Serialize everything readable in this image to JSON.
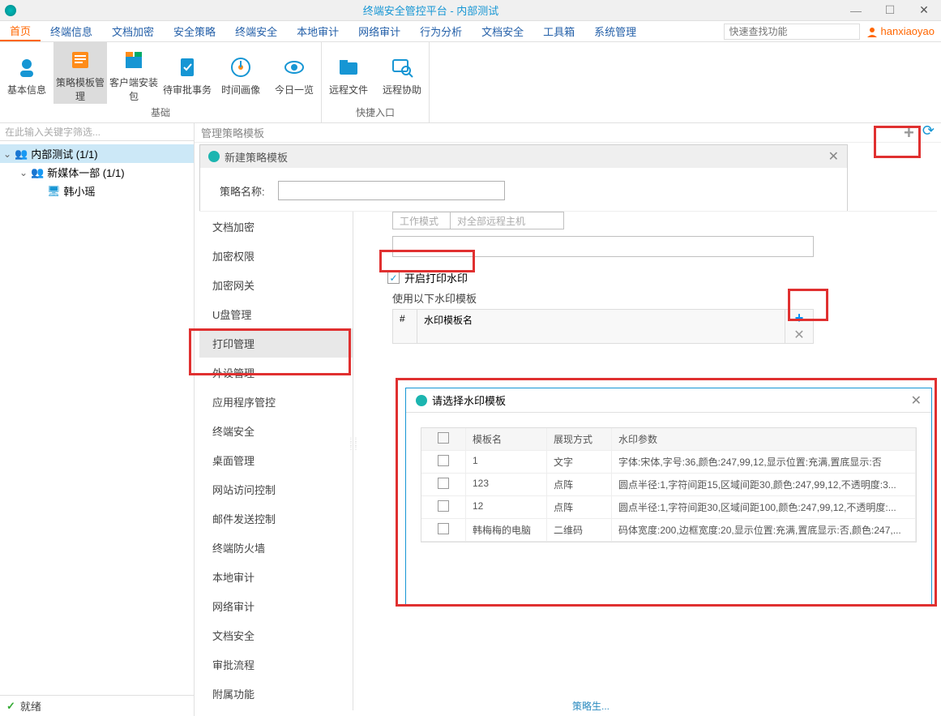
{
  "title": "终端安全管控平台 - 内部测试",
  "tabs": [
    "首页",
    "终端信息",
    "文档加密",
    "安全策略",
    "终端安全",
    "本地审计",
    "网络审计",
    "行为分析",
    "文档安全",
    "工具箱",
    "系统管理"
  ],
  "active_tab": 0,
  "search_placeholder": "快速查找功能",
  "user": "hanxiaoyao",
  "ribbon": {
    "groups": [
      {
        "label": "基础",
        "items": [
          "基本信息",
          "策略模板管理",
          "客户端安装包",
          "待审批事务",
          "时间画像",
          "今日一览"
        ],
        "active": 1
      },
      {
        "label": "快捷入口",
        "items": [
          "远程文件",
          "远程协助"
        ]
      }
    ]
  },
  "sidebar": {
    "filter_placeholder": "在此输入关键字筛选...",
    "tree": [
      {
        "label": "内部测试 (1/1)",
        "level": 0,
        "selected": true,
        "icon": "group"
      },
      {
        "label": "新媒体一部 (1/1)",
        "level": 1,
        "icon": "group"
      },
      {
        "label": "韩小瑶",
        "level": 2,
        "icon": "monitor"
      }
    ],
    "status": "就绪"
  },
  "panel_title": "管理策略模板",
  "modal": {
    "title": "新建策略模板",
    "name_label": "策略名称:"
  },
  "cats": [
    "文档加密",
    "加密权限",
    "加密网关",
    "U盘管理",
    "打印管理",
    "外设管理",
    "应用程序管控",
    "终端安全",
    "桌面管理",
    "网站访问控制",
    "邮件发送控制",
    "终端防火墙",
    "本地审计",
    "网络审计",
    "文档安全",
    "审批流程",
    "附属功能"
  ],
  "active_cat": 4,
  "right": {
    "mode_label": "工作模式",
    "mode_sel": "对全部远程主机",
    "enable_label": "开启打印水印",
    "use_label": "使用以下水印模板",
    "col_num": "#",
    "col_name": "水印模板名"
  },
  "picker": {
    "title": "请选择水印模板",
    "cols": [
      "",
      "模板名",
      "展现方式",
      "水印参数"
    ],
    "rows": [
      {
        "name": "1",
        "mode": "文字",
        "param": "字体:宋体,字号:36,颜色:247,99,12,显示位置:充满,置底显示:否"
      },
      {
        "name": "123",
        "mode": "点阵",
        "param": "圆点半径:1,字符间距15,区域间距30,颜色:247,99,12,不透明度:3..."
      },
      {
        "name": "12",
        "mode": "点阵",
        "param": "圆点半径:1,字符间距30,区域间距100,颜色:247,99,12,不透明度:..."
      },
      {
        "name": "韩梅梅的电脑",
        "mode": "二维码",
        "param": "码体宽度:200,边框宽度:20,显示位置:充满,置底显示:否,颜色:247,..."
      }
    ]
  },
  "footer_hint": "策略生..."
}
